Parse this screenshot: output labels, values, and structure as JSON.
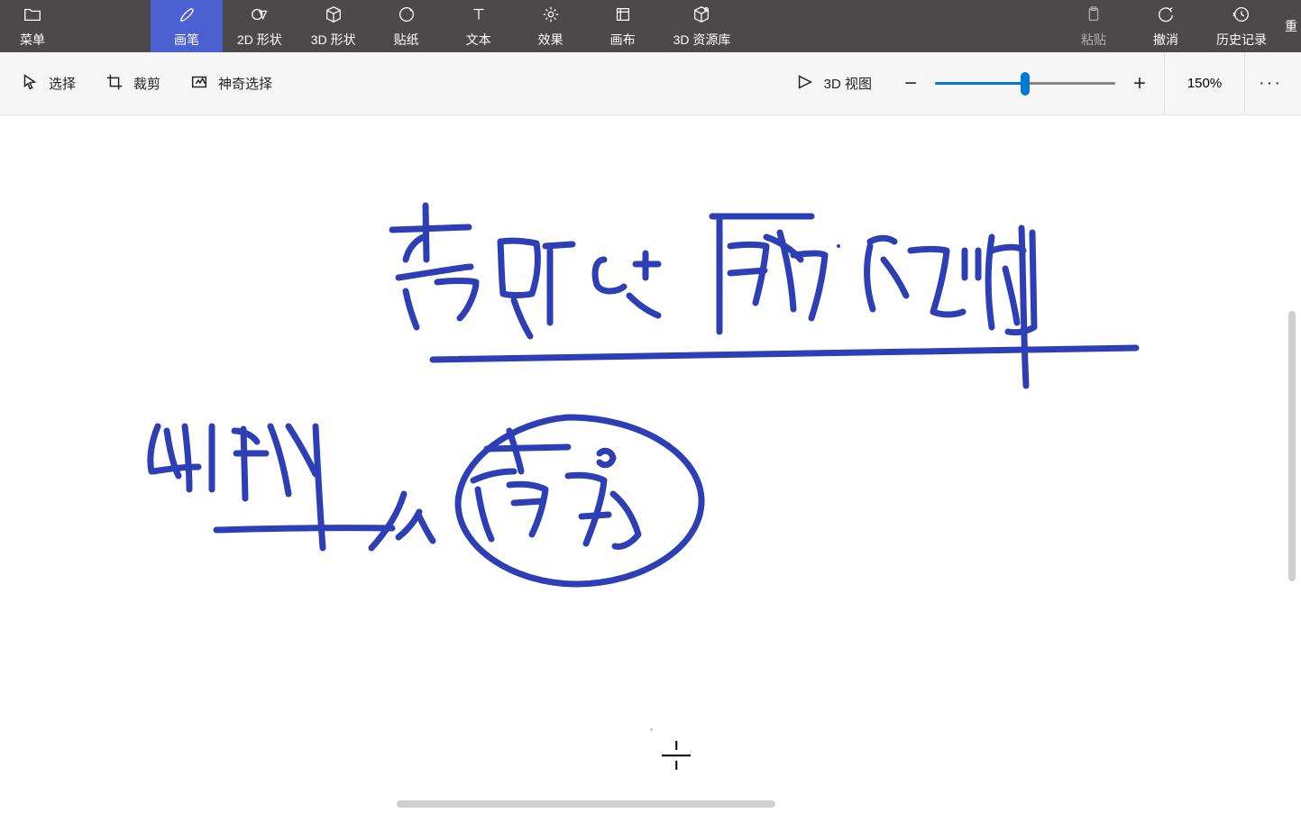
{
  "toolbar": {
    "menu": "菜单",
    "brush": "画笔",
    "shapes2d": "2D 形状",
    "shapes3d": "3D 形状",
    "stickers": "贴纸",
    "text": "文本",
    "effects": "效果",
    "canvas": "画布",
    "library3d": "3D 资源库",
    "paste": "粘贴",
    "undo": "撤消",
    "history": "历史记录",
    "redo_partial": "重"
  },
  "subbar": {
    "select": "选择",
    "crop": "裁剪",
    "magic": "神奇选择",
    "view3d": "3D 视图"
  },
  "zoom": {
    "level": "150%",
    "slider_percent": 50
  },
  "canvas": {
    "stroke_color": "#2e3fb5",
    "description": "handwritten Chinese notes with underline, circle, and arrow"
  }
}
